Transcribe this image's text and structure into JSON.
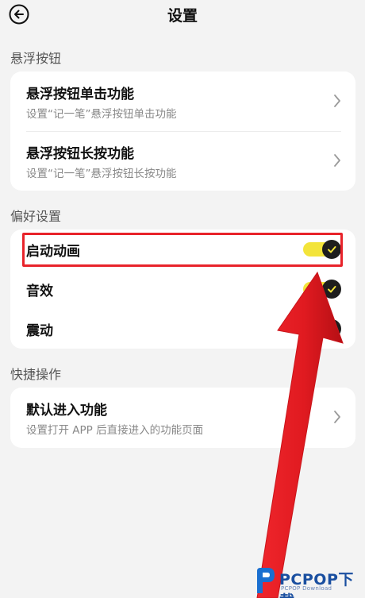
{
  "header": {
    "title": "设置"
  },
  "sections": [
    {
      "label": "悬浮按钮",
      "rows": [
        {
          "title": "悬浮按钮单击功能",
          "subtitle": "设置“记一笔”悬浮按钮单击功能"
        },
        {
          "title": "悬浮按钮长按功能",
          "subtitle": "设置“记一笔”悬浮按钮长按功能"
        }
      ]
    },
    {
      "label": "偏好设置",
      "toggles": [
        {
          "label": "启动动画",
          "on": true
        },
        {
          "label": "音效",
          "on": true
        },
        {
          "label": "震动",
          "on": true
        }
      ]
    },
    {
      "label": "快捷操作",
      "rows": [
        {
          "title": "默认进入功能",
          "subtitle": "设置打开 APP 后直接进入的功能页面"
        }
      ]
    }
  ],
  "colors": {
    "background": "#f3f3f3",
    "card": "#ffffff",
    "toggle_track": "#f3e43a",
    "toggle_knob": "#1e1e1e",
    "annotation_red": "#e8232a"
  },
  "icons": {
    "back": "back-arrow-circle-icon",
    "chevron": "chevron-right-icon",
    "check": "check-icon"
  },
  "watermark": {
    "brand": "PCPOP下载",
    "sub": "PCPOP Download"
  }
}
